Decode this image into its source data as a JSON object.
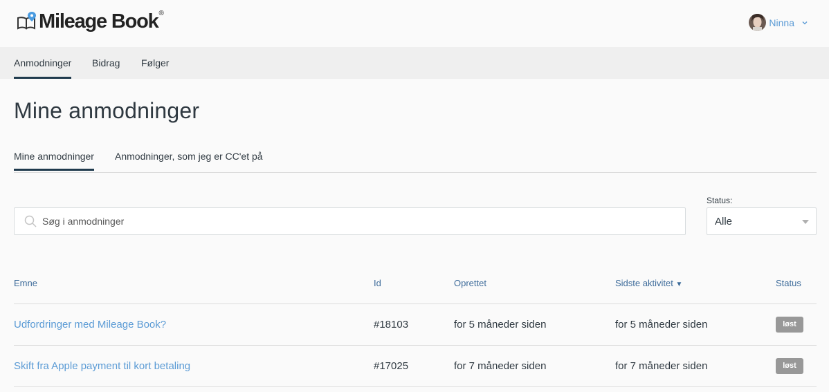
{
  "header": {
    "logo_text": "Mileage Book",
    "logo_mark": "®",
    "user_name": "Ninna"
  },
  "nav": {
    "items": [
      {
        "label": "Anmodninger"
      },
      {
        "label": "Bidrag"
      },
      {
        "label": "Følger"
      }
    ],
    "active": "Anmodninger"
  },
  "page": {
    "title": "Mine anmodninger"
  },
  "tabs": [
    {
      "label": "Mine anmodninger"
    },
    {
      "label": "Anmodninger, som jeg er CC'et på"
    }
  ],
  "search": {
    "placeholder": "Søg i anmodninger"
  },
  "status_filter": {
    "label": "Status:",
    "value": "Alle"
  },
  "table": {
    "headers": {
      "subject": "Emne",
      "id": "Id",
      "created": "Oprettet",
      "last_activity": "Sidste aktivitet",
      "sort_indicator": "▼",
      "status": "Status"
    },
    "rows": [
      {
        "subject": "Udfordringer med Mileage Book?",
        "id": "#18103",
        "created": "for 5 måneder siden",
        "last_activity": "for 5 måneder siden",
        "status": "løst"
      },
      {
        "subject": "Skift fra Apple payment til kort betaling",
        "id": "#17025",
        "created": "for 7 måneder siden",
        "last_activity": "for 7 måneder siden",
        "status": "løst"
      }
    ]
  },
  "colors": {
    "link": "#5b9bd5",
    "header_text": "#3d6b9a",
    "active_underline": "#1f3a4d",
    "badge_bg": "#989898",
    "nav_bg": "#efefef"
  }
}
